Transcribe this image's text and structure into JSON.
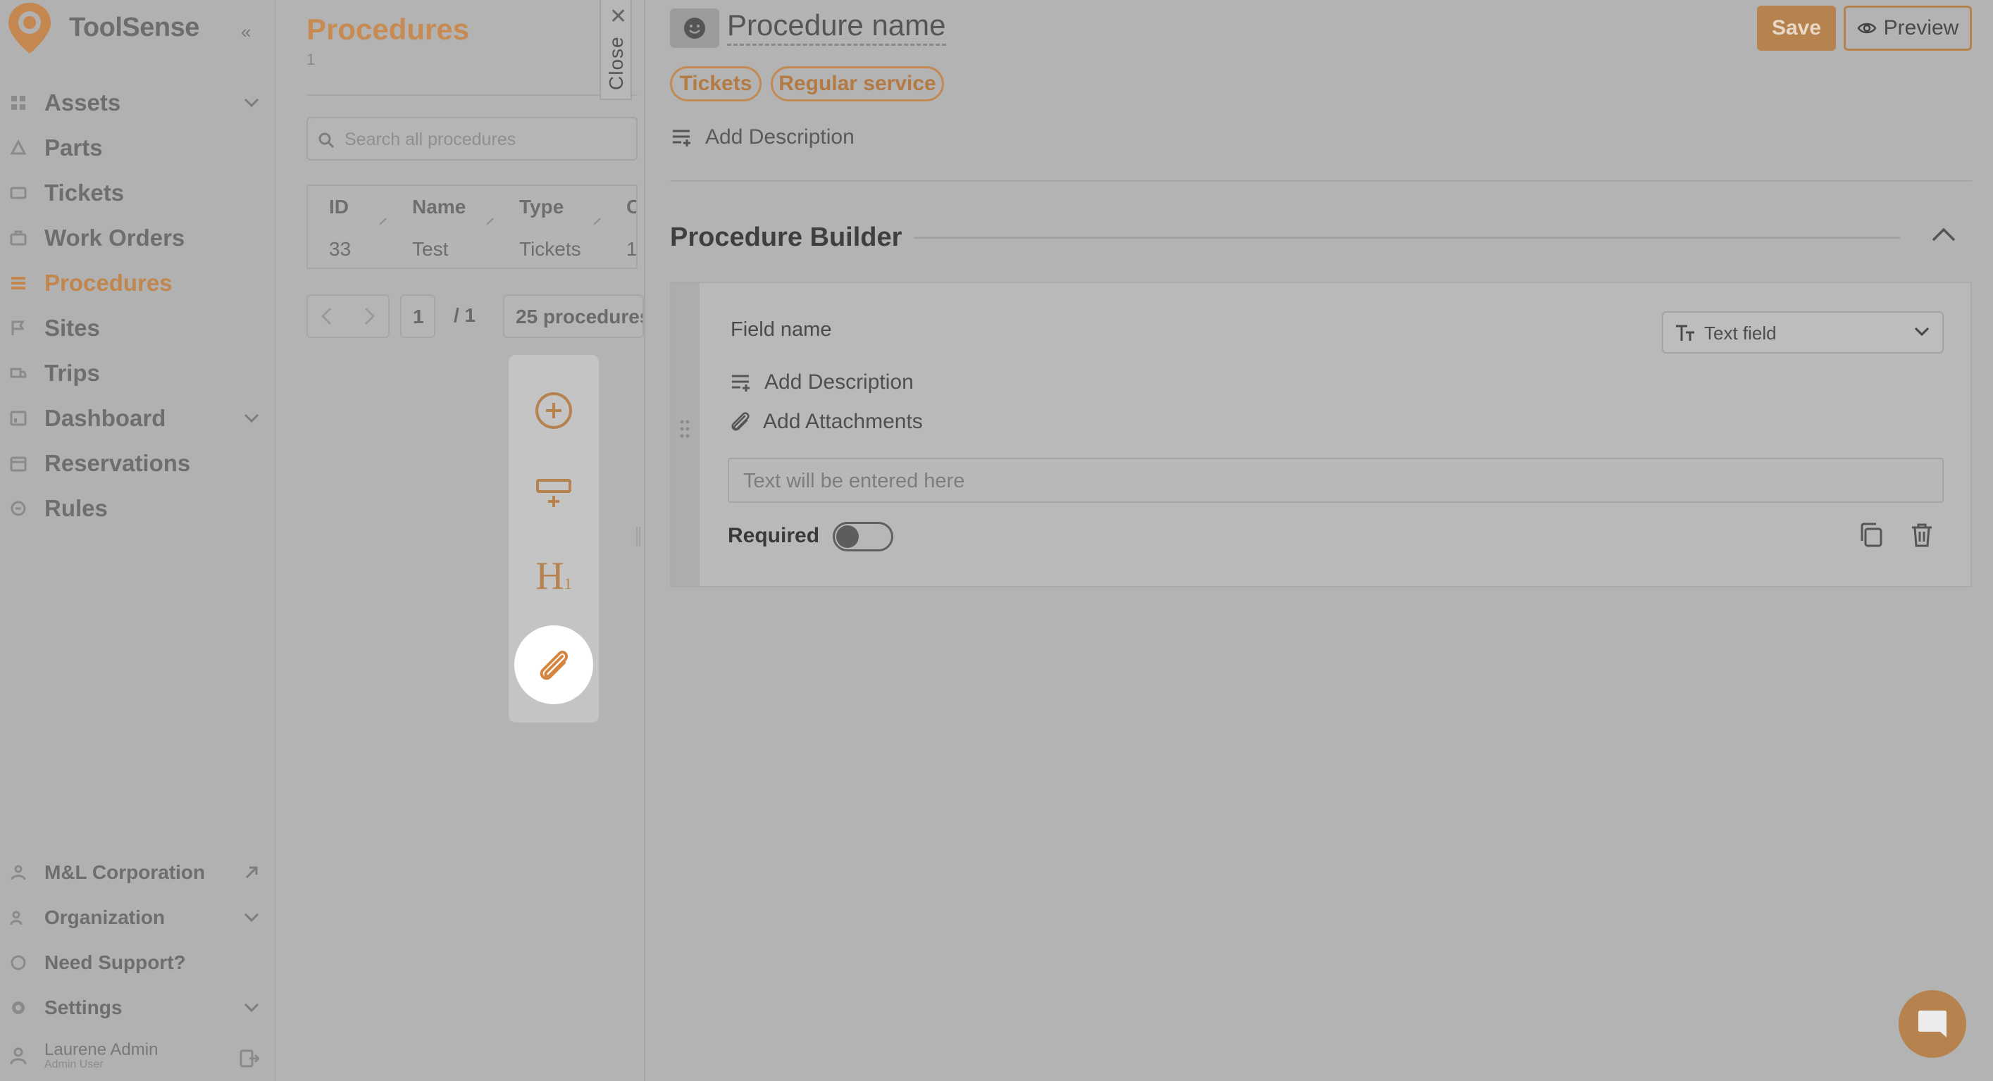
{
  "brand": "ToolSense",
  "colors": {
    "accent": "#c78a52",
    "overlay_gray": "#b3b3b3"
  },
  "sidebar": {
    "items": [
      {
        "label": "Assets",
        "icon": "grid-icon",
        "has_chevron": true
      },
      {
        "label": "Parts",
        "icon": "parts-icon"
      },
      {
        "label": "Tickets",
        "icon": "ticket-icon"
      },
      {
        "label": "Work Orders",
        "icon": "briefcase-icon"
      },
      {
        "label": "Procedures",
        "icon": "list-icon",
        "active": true
      },
      {
        "label": "Sites",
        "icon": "flag-icon"
      },
      {
        "label": "Trips",
        "icon": "truck-icon"
      },
      {
        "label": "Dashboard",
        "icon": "dashboard-icon",
        "has_chevron": true
      },
      {
        "label": "Reservations",
        "icon": "calendar-icon"
      },
      {
        "label": "Rules",
        "icon": "rules-icon"
      }
    ],
    "bottom": [
      {
        "label": "M&L Corporation",
        "icon": "company-icon"
      },
      {
        "label": "Organization",
        "icon": "organization-icon"
      },
      {
        "label": "Need Support?",
        "icon": "support-icon"
      },
      {
        "label": "Settings",
        "icon": "settings-icon"
      }
    ],
    "user": {
      "name": "Laurene Admin",
      "role": "Admin User"
    }
  },
  "list_panel": {
    "title": "Procedures",
    "count": "1",
    "search_placeholder": "Search all procedures",
    "columns": [
      "ID",
      "Name",
      "Type",
      "C"
    ],
    "rows": [
      [
        "33",
        "Test",
        "Tickets",
        "1"
      ]
    ],
    "pagination": {
      "page": "1",
      "total": "/ 1",
      "page_size": "25 procedures"
    }
  },
  "close_tab": {
    "label": "Close"
  },
  "toolbar": {
    "tools": [
      "add-field-icon",
      "add-section-icon",
      "heading-icon",
      "attachment-icon"
    ],
    "heading_label": "H",
    "heading_sub": "1"
  },
  "editor": {
    "procedure_name": "Procedure name",
    "save_label": "Save",
    "preview_label": "Preview",
    "tags": [
      "Tickets",
      "Regular service"
    ],
    "add_description": "Add Description",
    "builder_title": "Procedure Builder",
    "field": {
      "name": "Field name",
      "type": "Text field",
      "add_description": "Add Description",
      "add_attachments": "Add Attachments",
      "input_placeholder": "Text will be entered here",
      "required_label": "Required",
      "required": false
    }
  }
}
